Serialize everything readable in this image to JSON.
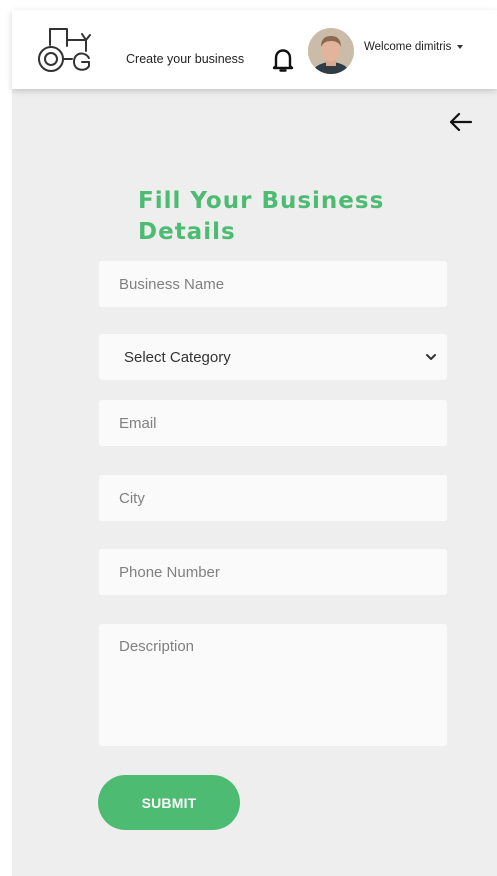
{
  "navbar": {
    "logo_icon": "tractor-logo-icon",
    "create_link": "Create your business",
    "bell_icon": "bell-icon",
    "user_label": "Welcome dimitris"
  },
  "back_icon": "arrow-left-icon",
  "form": {
    "title": "Fill Your Business Details",
    "business_name_placeholder": "Business Name",
    "category_label": "Select Category",
    "email_placeholder": "Email",
    "city_placeholder": "City",
    "phone_placeholder": "Phone Number",
    "description_placeholder": "Description",
    "submit_label": "SUBMIT"
  },
  "colors": {
    "accent": "#4dbb72",
    "background": "#eeeeee",
    "field": "#fafafa"
  }
}
